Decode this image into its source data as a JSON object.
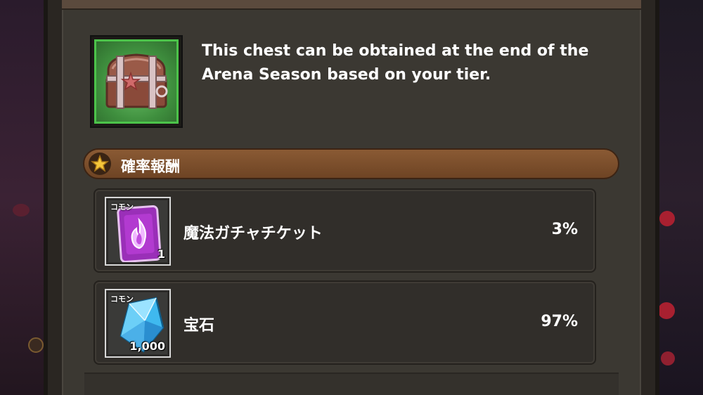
{
  "chest": {
    "icon": "treasure-chest-icon",
    "description": "This chest can be obtained at the end of the Arena Season based on your tier."
  },
  "section": {
    "icon": "star-icon",
    "title": "確率報酬"
  },
  "rewards": [
    {
      "rarity": "コモン",
      "icon": "magic-gacha-ticket-icon",
      "quantity": "1",
      "name": "魔法ガチャチケット",
      "probability": "3%"
    },
    {
      "rarity": "コモン",
      "icon": "gem-icon",
      "quantity": "1,000",
      "name": "宝石",
      "probability": "97%"
    }
  ],
  "colors": {
    "panel": "#3b3832",
    "header": "#7a4d2b",
    "chest_border": "#4cc34a",
    "ticket": "#b23ad0",
    "gem": "#3fb9ef"
  }
}
